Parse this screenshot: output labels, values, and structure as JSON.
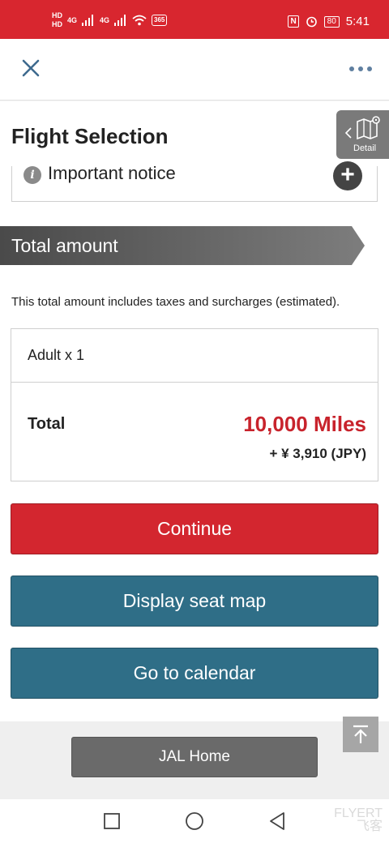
{
  "status_bar": {
    "time": "5:41",
    "battery": "80",
    "hd1": "HD",
    "hd2": "HD",
    "net1": "4G",
    "net2": "4G",
    "badge": "365",
    "color": "#d8262f"
  },
  "topbar": {
    "close_icon": "close-icon",
    "more_icon": "more-icon"
  },
  "page": {
    "title": "Flight Selection"
  },
  "detail_tab": {
    "label": "Detail",
    "icon": "map-pin-icon"
  },
  "notice": {
    "icon": "info-icon",
    "text": "Important notice",
    "expand_glyph": "+"
  },
  "total": {
    "heading": "Total amount",
    "note": "This total amount includes taxes and surcharges (estimated).",
    "passengers": "Adult x 1",
    "total_label": "Total",
    "miles": "10,000 Miles",
    "yen": "+ ¥ 3,910 (JPY)"
  },
  "buttons": {
    "continue": "Continue",
    "seat_map": "Display seat map",
    "calendar": "Go to calendar"
  },
  "footer": {
    "home": "JAL Home",
    "to_top_icon": "arrow-up-icon"
  },
  "watermark": {
    "line1": "FLYERT",
    "line2": "飞客"
  },
  "colors": {
    "brand_red": "#d3262f",
    "miles_red": "#c8232c",
    "action_blue": "#2f6e87",
    "banner_gray": "#5a5a5a"
  }
}
